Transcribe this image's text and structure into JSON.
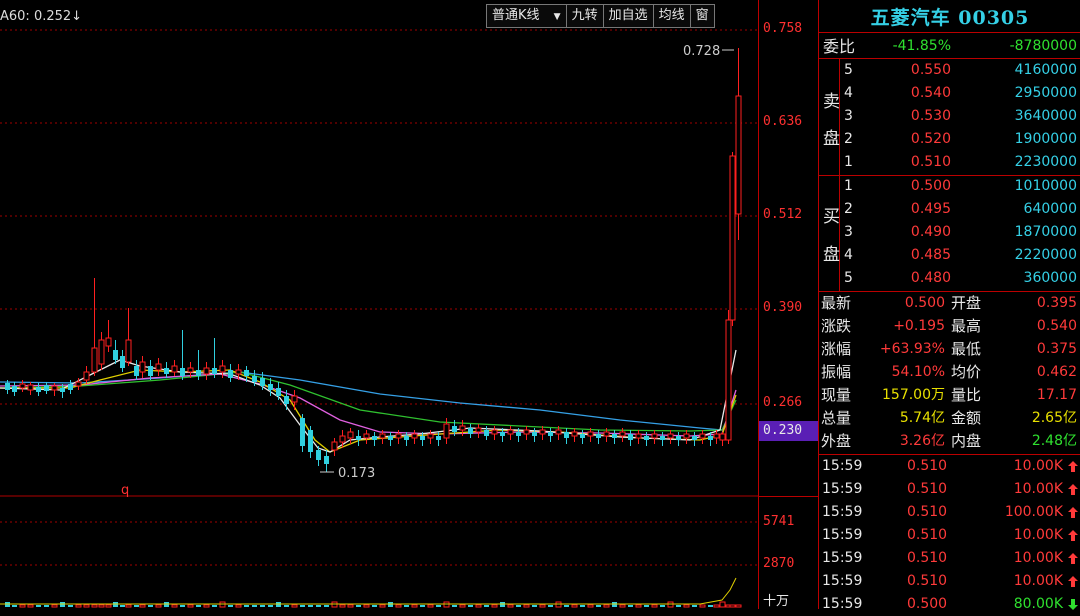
{
  "chart": {
    "ma_label": "A60: 0.252↓",
    "toolbar": [
      "普通K线",
      "九转",
      "加自选",
      "均线",
      "窗"
    ],
    "price_axis": [
      "0.758",
      "0.636",
      "0.512",
      "0.390",
      "0.266",
      "0.230"
    ],
    "volume_axis": [
      "5741",
      "2870",
      "十万"
    ],
    "high_label": "0.728",
    "low_label": "0.173",
    "marker": "q",
    "colors": {
      "up": "#ff2020",
      "down": "#30d0e0",
      "grid": "#b00000",
      "highlight": "#6a1fbf"
    }
  },
  "panel": {
    "title": "五菱汽车 00305",
    "weibi": {
      "label": "委比",
      "pct": "-41.85%",
      "diff": "-8780000"
    },
    "sell_label_1": "卖",
    "sell_label_2": "盘",
    "buy_label_1": "买",
    "buy_label_2": "盘",
    "sell": [
      {
        "n": "5",
        "price": "0.550",
        "vol": "4160000"
      },
      {
        "n": "4",
        "price": "0.540",
        "vol": "2950000"
      },
      {
        "n": "3",
        "price": "0.530",
        "vol": "3640000"
      },
      {
        "n": "2",
        "price": "0.520",
        "vol": "1900000"
      },
      {
        "n": "1",
        "price": "0.510",
        "vol": "2230000"
      }
    ],
    "buy": [
      {
        "n": "1",
        "price": "0.500",
        "vol": "1010000"
      },
      {
        "n": "2",
        "price": "0.495",
        "vol": "640000"
      },
      {
        "n": "3",
        "price": "0.490",
        "vol": "1870000"
      },
      {
        "n": "4",
        "price": "0.485",
        "vol": "2220000"
      },
      {
        "n": "5",
        "price": "0.480",
        "vol": "360000"
      }
    ],
    "quote": [
      {
        "l1": "最新",
        "v1": "0.500",
        "c1": "red",
        "l2": "开盘",
        "v2": "0.395",
        "c2": "red"
      },
      {
        "l1": "涨跌",
        "v1": "+0.195",
        "c1": "red",
        "l2": "最高",
        "v2": "0.540",
        "c2": "red"
      },
      {
        "l1": "涨幅",
        "v1": "+63.93%",
        "c1": "red",
        "l2": "最低",
        "v2": "0.375",
        "c2": "red"
      },
      {
        "l1": "振幅",
        "v1": "54.10%",
        "c1": "red",
        "l2": "均价",
        "v2": "0.462",
        "c2": "red"
      },
      {
        "l1": "现量",
        "v1": "157.00万",
        "c1": "yellow",
        "l2": "量比",
        "v2": "17.17",
        "c2": "red"
      },
      {
        "l1": "总量",
        "v1": "5.74亿",
        "c1": "yellow",
        "l2": "金额",
        "v2": "2.65亿",
        "c2": "yellow"
      },
      {
        "l1": "外盘",
        "v1": "3.26亿",
        "c1": "red",
        "l2": "内盘",
        "v2": "2.48亿",
        "c2": "green"
      }
    ],
    "ticks": [
      {
        "time": "15:59",
        "price": "0.510",
        "vol": "10.00K",
        "dir": "up"
      },
      {
        "time": "15:59",
        "price": "0.510",
        "vol": "10.00K",
        "dir": "up"
      },
      {
        "time": "15:59",
        "price": "0.510",
        "vol": "100.00K",
        "dir": "up"
      },
      {
        "time": "15:59",
        "price": "0.510",
        "vol": "10.00K",
        "dir": "up"
      },
      {
        "time": "15:59",
        "price": "0.510",
        "vol": "10.00K",
        "dir": "up"
      },
      {
        "time": "15:59",
        "price": "0.510",
        "vol": "10.00K",
        "dir": "up"
      },
      {
        "time": "15:59",
        "price": "0.500",
        "vol": "80.00K",
        "dir": "down"
      }
    ]
  }
}
